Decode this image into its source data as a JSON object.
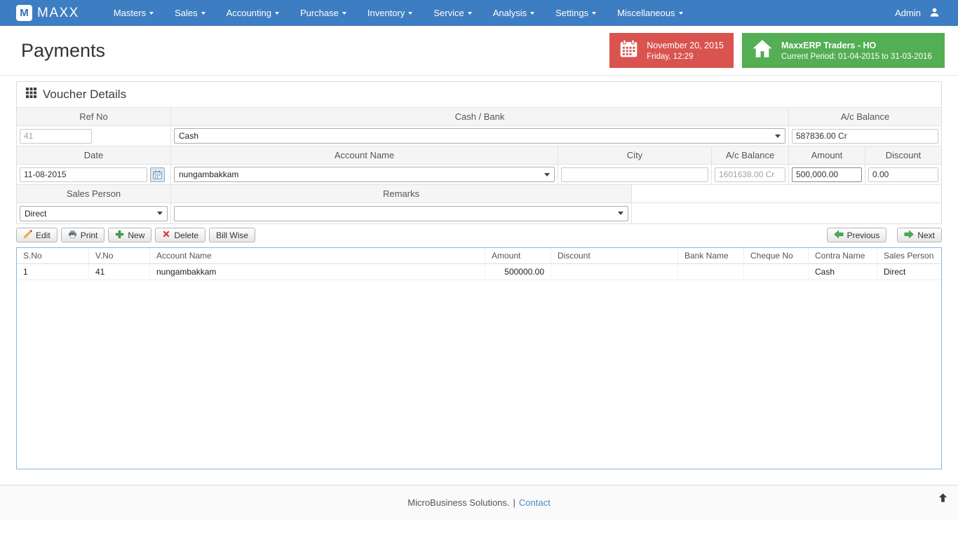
{
  "colors": {
    "navbar": "#3d7dc1",
    "date_box": "#d9534f",
    "company_box": "#54ae54",
    "link": "#4a89c8",
    "table_border": "#8db6d9"
  },
  "navbar": {
    "logo_letter": "M",
    "brand": "MAXX",
    "items": [
      {
        "label": "Masters"
      },
      {
        "label": "Sales"
      },
      {
        "label": "Accounting"
      },
      {
        "label": "Purchase"
      },
      {
        "label": "Inventory"
      },
      {
        "label": "Service"
      },
      {
        "label": "Analysis"
      },
      {
        "label": "Settings"
      },
      {
        "label": "Miscellaneous"
      }
    ],
    "user": "Admin"
  },
  "header": {
    "title": "Payments",
    "date_box": {
      "line1": "November 20, 2015",
      "line2": "Friday, 12:29"
    },
    "company_box": {
      "line1": "MaxxERP Traders - HO",
      "line2": "Current Period: 01-04-2015 to 31-03-2016"
    }
  },
  "voucher": {
    "title": "Voucher Details",
    "labels": {
      "ref_no": "Ref No",
      "cash_bank": "Cash / Bank",
      "ac_balance": "A/c Balance",
      "date": "Date",
      "account_name": "Account Name",
      "city": "City",
      "ac_balance2": "A/c Balance",
      "amount": "Amount",
      "discount": "Discount",
      "sales_person": "Sales Person",
      "remarks": "Remarks"
    },
    "values": {
      "ref_no": "41",
      "cash_bank": "Cash",
      "ac_balance": "587836.00 Cr",
      "date": "11-08-2015",
      "account_name": "nungambakkam",
      "city": "",
      "ac_balance2": "1601638.00 Cr",
      "amount": "500,000.00",
      "discount": "0.00",
      "sales_person": "Direct",
      "remarks": ""
    }
  },
  "toolbar": {
    "edit": "Edit",
    "print": "Print",
    "new": "New",
    "delete": "Delete",
    "bill_wise": "Bill Wise",
    "previous": "Previous",
    "next": "Next"
  },
  "table": {
    "columns": [
      "S.No",
      "V.No",
      "Account Name",
      "Amount",
      "Discount",
      "Bank Name",
      "Cheque No",
      "Contra Name",
      "Sales Person"
    ],
    "rows": [
      [
        "1",
        "41",
        "nungambakkam",
        "500000.00",
        "",
        "",
        "",
        "Cash",
        "Direct"
      ]
    ]
  },
  "footer": {
    "text": "MicroBusiness Solutions.",
    "separator": "|",
    "link": "Contact"
  }
}
